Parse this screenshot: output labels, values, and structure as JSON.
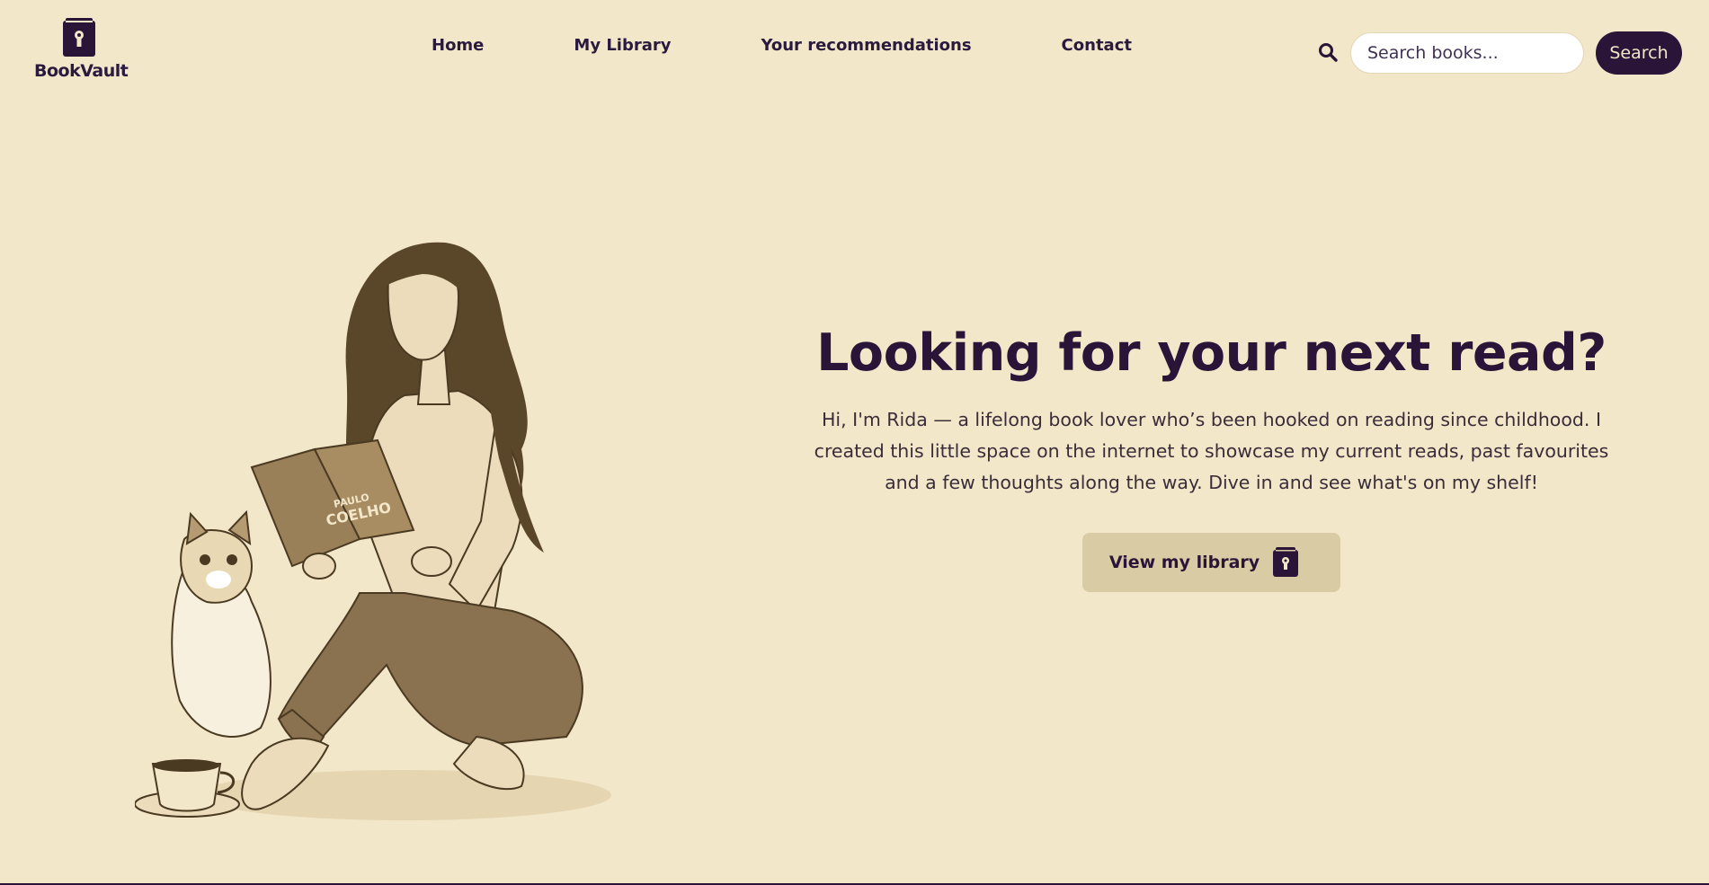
{
  "brand": {
    "name": "BookVault",
    "logo_icon": "locked-book-icon"
  },
  "nav": {
    "items": [
      "Home",
      "My Library",
      "Your recommendations",
      "Contact"
    ]
  },
  "search": {
    "icon": "search-icon",
    "placeholder": "Search books...",
    "button_label": "Search"
  },
  "hero": {
    "title": "Looking for your next read?",
    "text": "Hi, I'm Rida — a lifelong book lover who’s been hooked on reading since childhood. I created this little space on the internet to showcase my current reads, past favourites and a few thoughts along the way. Dive in and see what's on my shelf!",
    "cta_label": "View my library",
    "cta_icon": "locked-book-icon"
  },
  "illustration": {
    "description_icon": "woman-reading-with-cat-illustration",
    "book_author_top": "PAULO",
    "book_author_bottom": "COELHO"
  },
  "colors": {
    "background": "#f3e7c9",
    "primary": "#2a1438",
    "button_bg": "#d9cba3"
  }
}
